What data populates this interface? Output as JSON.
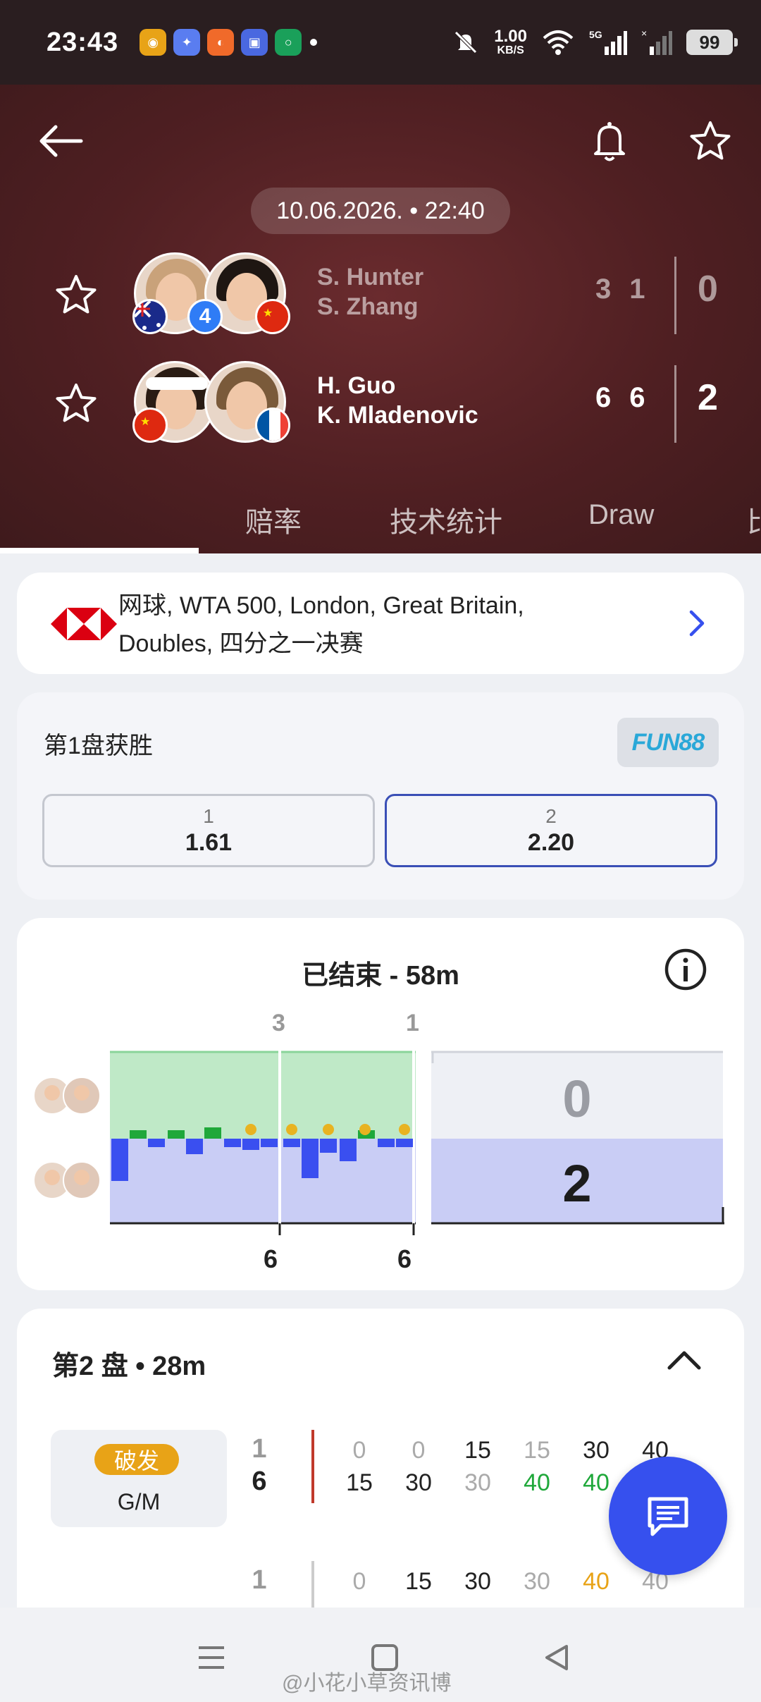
{
  "status_bar": {
    "time": "23:43",
    "net_speed_value": "1.00",
    "net_speed_unit": "KB/S",
    "network": "5G",
    "battery": "99"
  },
  "header": {
    "datetime": "10.06.2026. • 22:40",
    "team1": {
      "player1": "S. Hunter",
      "player2": "S. Zhang",
      "seed": "4",
      "set_scores": [
        "3",
        "1"
      ],
      "sets_won": "0"
    },
    "team2": {
      "player1": "H. Guo",
      "player2": "K. Mladenovic",
      "set_scores": [
        "6",
        "6"
      ],
      "sets_won": "2"
    },
    "tabs": [
      "赔率",
      "技术统计",
      "Draw",
      "比"
    ]
  },
  "tournament": {
    "line1": "网球, WTA 500, London, Great Britain,",
    "line2": "Doubles, 四分之一决赛"
  },
  "odds": {
    "title": "第1盘获胜",
    "brand": "FUN88",
    "options": [
      {
        "label": "1",
        "value": "1.61"
      },
      {
        "label": "2",
        "value": "2.20"
      }
    ]
  },
  "timeline": {
    "title": "已结束 - 58m",
    "set1_top": "3",
    "set2_top": "1",
    "set1_bottom": "6",
    "set2_bottom": "6",
    "total_top": "0",
    "total_bottom": "2",
    "colors": {
      "team1": "#bfe9c7",
      "team2": "#c9cdf5",
      "bar1": "#1fa83a",
      "bar2": "#3a4ff0"
    }
  },
  "set_detail": {
    "title": "第2 盘 • 28m",
    "break_badge": "破发",
    "break_label": "G/M",
    "games": [
      {
        "team1_games": "1",
        "team2_games": "6",
        "team1_points": [
          "0",
          "0",
          "15",
          "15",
          "30",
          "40"
        ],
        "team2_points": [
          "15",
          "30",
          "30",
          "40",
          "40",
          ""
        ]
      },
      {
        "team1_games": "1",
        "team1_points": [
          "0",
          "15",
          "30",
          "30",
          "40",
          "40"
        ]
      }
    ]
  },
  "watermark": "@小花小草资讯博"
}
